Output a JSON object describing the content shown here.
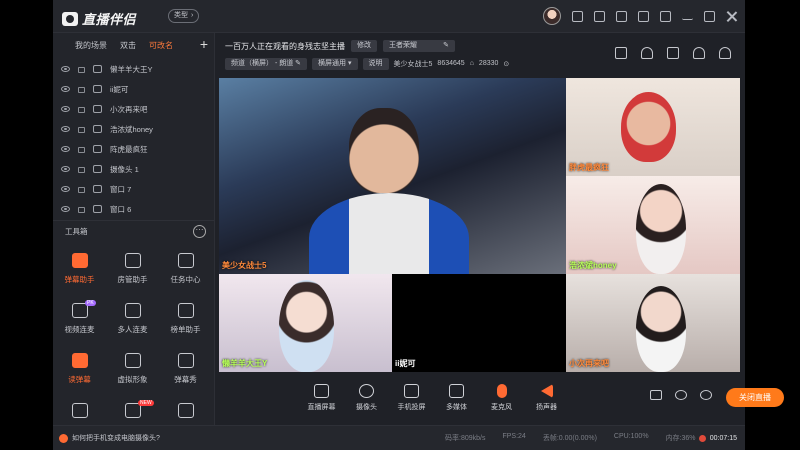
{
  "app": {
    "title": "直播伴侣",
    "mode": "类型"
  },
  "left_panel": {
    "tabs": [
      "我的场景",
      "双击",
      "可改名"
    ],
    "active_tab": 2,
    "add": "+",
    "scenes": [
      "懒羊羊大王Y",
      "ii妮可",
      "小次再来吧",
      "浩浓斌honey",
      "阵虎最疯狂",
      "摄像头 1",
      "窗口 7",
      "窗口 6"
    ],
    "toolbox_title": "工具箱",
    "toolbox_more": "···",
    "tools": [
      {
        "label": "弹幕助手",
        "active": true
      },
      {
        "label": "房管助手"
      },
      {
        "label": "任务中心"
      },
      {
        "label": "视频连麦",
        "badge": "PK"
      },
      {
        "label": "多人连麦"
      },
      {
        "label": "榜单助手"
      },
      {
        "label": "读弹幕",
        "active": true
      },
      {
        "label": "虚拟形象"
      },
      {
        "label": "弹幕秀"
      },
      {
        "label": ""
      },
      {
        "label": "",
        "badge": "NEW"
      },
      {
        "label": ""
      }
    ]
  },
  "topic": {
    "title": "一百万人正在观看的身残志坚主播",
    "edit": "修改",
    "tag": "王者荣耀"
  },
  "info": {
    "quality_label": "频道（横屏）",
    "quality_value": "朗道",
    "template": "横屏通用",
    "desc": "说明",
    "name": "美少女战士5",
    "id": "8634645",
    "fans": "28330"
  },
  "stage": {
    "main_label": "美少女战士5",
    "tr_label": "胖虎最疯狂",
    "mr_label": "浩浓斌honey",
    "bl_label": "懒羊羊大王Y",
    "bm_label": "ii妮可",
    "br_label": "小次再来吧"
  },
  "bottom_tools": [
    "直播屏幕",
    "摄像头",
    "手机投屏",
    "多媒体",
    "麦克风",
    "扬声器"
  ],
  "go_live": "关闭直播",
  "status": {
    "tip": "如何把手机变成电脑摄像头?",
    "bitrate": "码率:809kb/s",
    "fps": "FPS:24",
    "drop": "丢帧:0.00(0.00%)",
    "cpu": "CPU:100%",
    "mem": "内存:36%",
    "timer": "00:07:15"
  },
  "colors": {
    "accent": "#ff7a1a",
    "bg": "#1f2127"
  }
}
